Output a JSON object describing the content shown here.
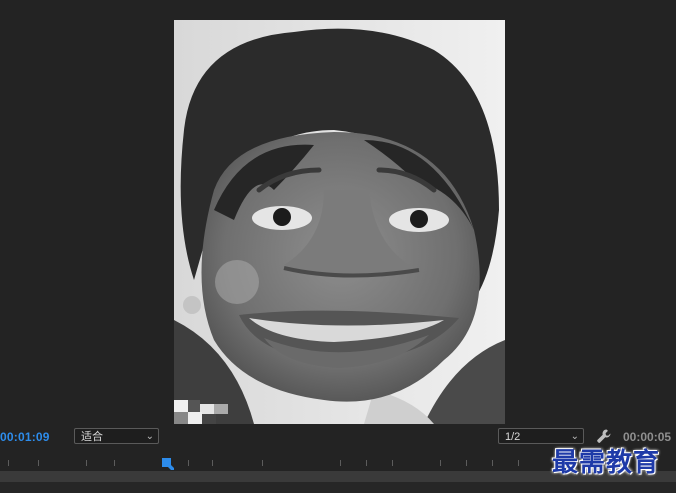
{
  "monitor": {
    "timecode_current": "00:01:09",
    "zoom_level": "适合",
    "resolution": "1/2",
    "timecode_duration": "00:00:05"
  },
  "preview": {
    "content": "grayscale portrait with face distortion effect"
  },
  "watermark": {
    "text": "最需教育"
  },
  "icons": {
    "settings": "wrench-icon",
    "dropdown": "chevron-down-icon",
    "playhead": "playhead-marker-icon"
  },
  "colors": {
    "timecode_accent": "#2d8ceb",
    "background": "#232323",
    "watermark": "#1e3aa8"
  }
}
